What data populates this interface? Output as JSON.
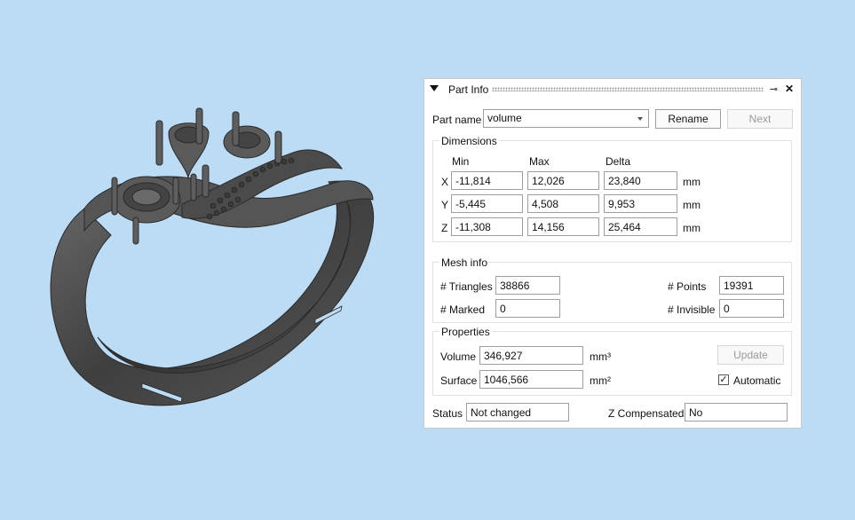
{
  "panel": {
    "title": "Part Info"
  },
  "part": {
    "label": "Part name",
    "value": "volume",
    "rename": "Rename",
    "next": "Next"
  },
  "dimensions": {
    "title": "Dimensions",
    "headers": [
      "Min",
      "Max",
      "Delta"
    ],
    "unit": "mm",
    "rows": [
      {
        "axis": "X",
        "min": "-11,814",
        "max": "12,026",
        "delta": "23,840"
      },
      {
        "axis": "Y",
        "min": "-5,445",
        "max": "4,508",
        "delta": "9,953"
      },
      {
        "axis": "Z",
        "min": "-11,308",
        "max": "14,156",
        "delta": "25,464"
      }
    ]
  },
  "mesh": {
    "title": "Mesh info",
    "triangles_label": "# Triangles",
    "triangles": "38866",
    "points_label": "# Points",
    "points": "19391",
    "marked_label": "# Marked",
    "marked": "0",
    "invisible_label": "# Invisible",
    "invisible": "0"
  },
  "properties": {
    "title": "Properties",
    "volume_label": "Volume",
    "volume": "346,927",
    "volume_unit": "mm³",
    "surface_label": "Surface",
    "surface": "1046,566",
    "surface_unit": "mm²",
    "update": "Update",
    "automatic": "Automatic",
    "automatic_checked": true
  },
  "footer": {
    "status_label": "Status",
    "status": "Not changed",
    "zcomp_label": "Z Compensated",
    "zcomp": "No"
  },
  "colors": {
    "background": "#bcdcf6",
    "model": "#4a4a4a"
  }
}
